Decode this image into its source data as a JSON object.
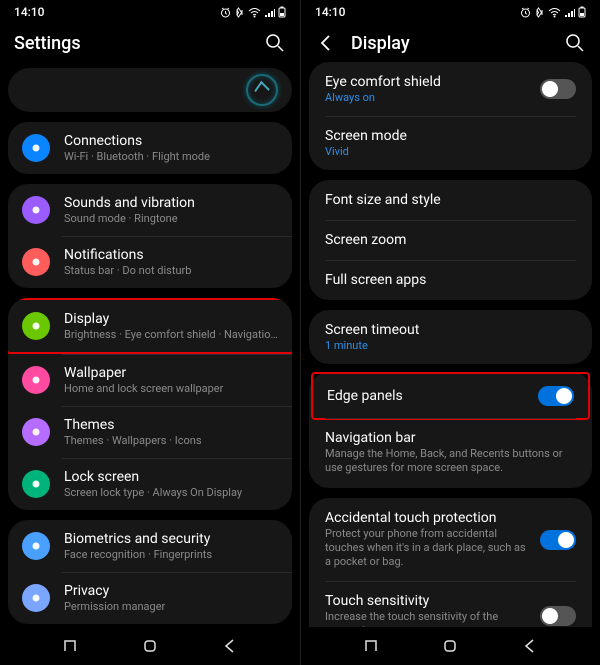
{
  "time": "14:10",
  "status_icons": [
    "alarm",
    "vibrate",
    "wifi",
    "signal",
    "battery"
  ],
  "left": {
    "title": "Settings",
    "items": [
      {
        "icon_bg": "#0a84ff",
        "title": "Connections",
        "sub": "Wi-Fi · Bluetooth · Flight mode",
        "name": "settings-item-connections"
      },
      {
        "icon_bg": "#9b5cff",
        "title": "Sounds and vibration",
        "sub": "Sound mode · Ringtone",
        "name": "settings-item-sounds"
      },
      {
        "icon_bg": "#ff5c5c",
        "title": "Notifications",
        "sub": "Status bar · Do not disturb",
        "name": "settings-item-notifications"
      },
      {
        "icon_bg": "#6bc700",
        "title": "Display",
        "sub": "Brightness · Eye comfort shield · Navigation bar",
        "highlight": true,
        "name": "settings-item-display"
      },
      {
        "icon_bg": "#ff4aa2",
        "title": "Wallpaper",
        "sub": "Home and lock screen wallpaper",
        "name": "settings-item-wallpaper"
      },
      {
        "icon_bg": "#b56cff",
        "title": "Themes",
        "sub": "Themes · Wallpapers · Icons",
        "name": "settings-item-themes"
      },
      {
        "icon_bg": "#00b37a",
        "title": "Lock screen",
        "sub": "Screen lock type · Always On Display",
        "name": "settings-item-lock-screen"
      },
      {
        "icon_bg": "#4aa0ff",
        "title": "Biometrics and security",
        "sub": "Face recognition · Fingerprints",
        "name": "settings-item-biometrics"
      },
      {
        "icon_bg": "#7aa6ff",
        "title": "Privacy",
        "sub": "Permission manager",
        "name": "settings-item-privacy"
      }
    ]
  },
  "right": {
    "title": "Display",
    "sections": [
      [
        {
          "title": "Eye comfort shield",
          "sub": "Always on",
          "sub_class": "blue",
          "toggle": "off",
          "name": "display-eye-comfort"
        },
        {
          "title": "Screen mode",
          "sub": "Vivid",
          "sub_class": "blue",
          "name": "display-screen-mode"
        }
      ],
      [
        {
          "title": "Font size and style",
          "name": "display-font"
        },
        {
          "title": "Screen zoom",
          "name": "display-zoom"
        },
        {
          "title": "Full screen apps",
          "name": "display-fullscreen-apps"
        }
      ],
      [
        {
          "title": "Screen timeout",
          "sub": "1 minute",
          "sub_class": "blue",
          "name": "display-timeout"
        }
      ],
      [
        {
          "title": "Edge panels",
          "toggle": "on",
          "highlight": true,
          "name": "display-edge-panels"
        },
        {
          "title": "Navigation bar",
          "sub": "Manage the Home, Back, and Recents buttons or use gestures for more screen space.",
          "sub_class": "gray",
          "name": "display-navigation-bar"
        }
      ],
      [
        {
          "title": "Accidental touch protection",
          "sub": "Protect your phone from accidental touches when it's in a dark place, such as a pocket or bag.",
          "sub_class": "gray",
          "toggle": "on",
          "name": "display-accidental-touch"
        },
        {
          "title": "Touch sensitivity",
          "sub": "Increase the touch sensitivity of the screen for use with screen protectors",
          "sub_class": "gray",
          "toggle": "off",
          "name": "display-touch-sensitivity"
        }
      ]
    ]
  }
}
